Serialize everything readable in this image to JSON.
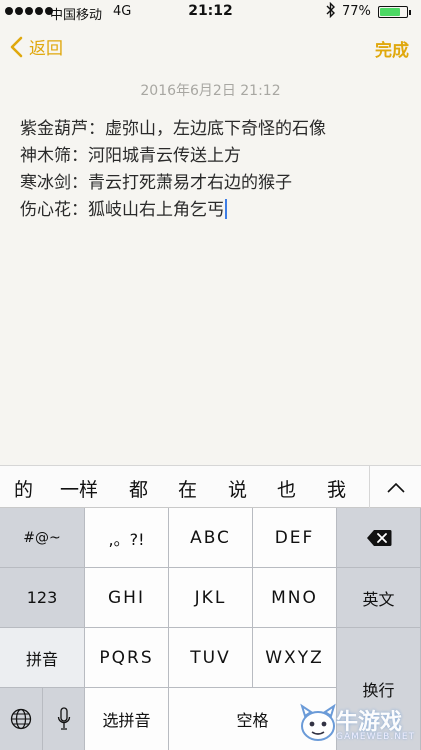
{
  "status_bar": {
    "carrier": "中国移动",
    "network": "4G",
    "time": "21:12",
    "battery_percent": "77%",
    "battery_level": 0.77,
    "battery_color": "#4cd964",
    "bluetooth_icon": "bluetooth-icon"
  },
  "nav": {
    "back_label": "返回",
    "done_label": "完成",
    "accent_color": "#e0a80d"
  },
  "note": {
    "date": "2016年6月2日 21:12",
    "lines": [
      "紫金葫芦：虚弥山，左边底下奇怪的石像",
      "神木筛：河阳城青云传送上方",
      "寒冰剑：青云打死萧易才右边的猴子",
      "伤心花：狐岐山右上角乞丐"
    ]
  },
  "candidates": [
    "的",
    "一样",
    "都",
    "在",
    "说",
    "也",
    "我"
  ],
  "keyboard": {
    "row1": [
      "#@~",
      ",。?!",
      "ABC",
      "DEF"
    ],
    "row2": [
      "123",
      "GHI",
      "JKL",
      "MNO",
      "英文"
    ],
    "row3": [
      "拼音",
      "PQRS",
      "TUV",
      "WXYZ"
    ],
    "row4": [
      "选拼音",
      "空格"
    ],
    "return_label": "换行"
  },
  "watermark": {
    "title": "牛游戏",
    "sub": "GAMEWEB.NET"
  }
}
